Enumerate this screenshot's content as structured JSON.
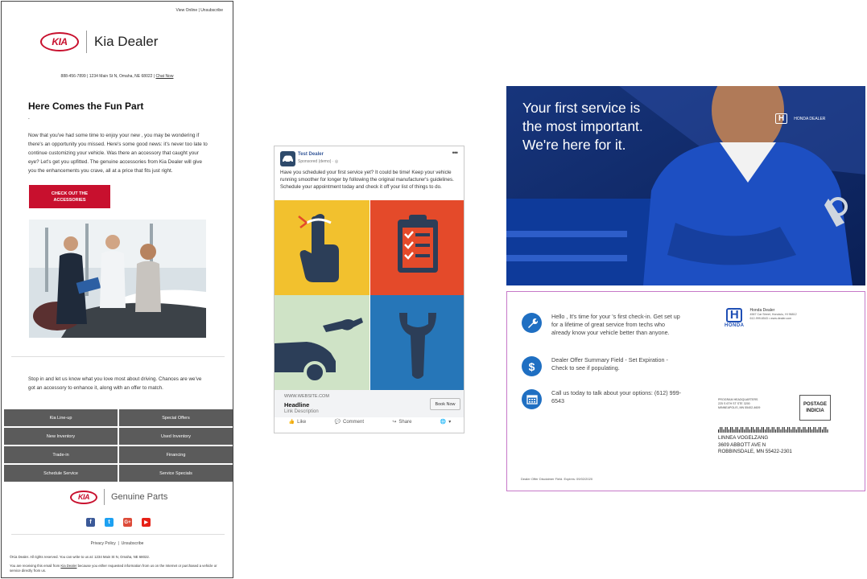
{
  "email": {
    "top_links": "View Online | Unsubscribe",
    "logo_text": "KIA",
    "dealer_name": "Kia Dealer",
    "contact_line": "888-456-7899 | 1234 Main St N, Omaha, NE 68022 | ",
    "chat_now": "Chat Now",
    "heading": "Here Comes the Fun Part",
    "dot": "-",
    "body1": "Now that you've had some time to enjoy your new , you may be wondering if there's an opportunity you missed. Here's some good news: it's never too late to continue customizing your vehicle. Was there an accessory that caught your eye? Let's get you upfitted. The genuine accessories from Kia Dealer will give you the enhancements you crave, all at a price that fits just right.",
    "cta": "CHECK OUT THE ACCESSORIES",
    "body2": "Stop in and let us know what you love most about driving. Chances are we've got an accessory to enhance it, along with an offer to match.",
    "nav": [
      "Kia Line-up",
      "Special Offers",
      "New Inventory",
      "Used Inventory",
      "Trade-in",
      "Financing",
      "Schedule Service",
      "Service Specials"
    ],
    "genuine_parts": "Genuine Parts",
    "social": [
      "f",
      "t",
      "G+",
      "▶"
    ],
    "privacy": "Privacy Policy",
    "unsubscribe": "Unsubscribe",
    "footer_copyright": "©Kia Dealer. All rights reserved. You can write to us at: 1234 Main St N, Omaha, NE 68022.",
    "footer_receiving_a": "You are receiving this email from ",
    "footer_receiving_link": "Kia Dealer",
    "footer_receiving_b": " because you either requested information from us on the Internet or purchased a vehicle or service directly from us."
  },
  "fb": {
    "page_name": "Test Dealer",
    "sponsored": "Sponsored (demo) · ",
    "post_text": "Have you scheduled your first service yet? It could be time! Keep your vehicle running smoother for longer by following the original manufacturer's guidelines. Schedule your appointment today and check it off your list of things to do.",
    "site": "WWW.WEBSITE.COM",
    "headline": "Headline",
    "link_description": "Link Description",
    "button": "Book Now",
    "like": "Like",
    "comment": "Comment",
    "share": "Share",
    "colors": {
      "yellow": "#f2c12e",
      "red": "#e44a2a",
      "green": "#cfe3c6",
      "blue": "#2676b8",
      "navy": "#2c3e58"
    }
  },
  "honda_front": {
    "headline_lines": [
      "Your first service is",
      "the most important.",
      "We're here for it."
    ],
    "logo_text": "HONDA DEALER"
  },
  "honda_back": {
    "item1": "Hello , It's time for your 's first check-in. Get set up for a lifetime of great service from techs who already know your vehicle better than anyone.",
    "item2": "Dealer Offer Summary Field - Set Expiration - Check to see if populating.",
    "item3": "Call us today to talk about your options: (612) 999-6543",
    "brand": "HONDA",
    "dealer_name": "Honda Dealer",
    "dealer_address": "4567 Car Street, Honolulu, HI 96812",
    "dealer_contact": "612-999-6543 • www.dealer.com",
    "hq_lines": [
      "PROGRAM HEADQUARTERS",
      "225 S 6TH ST STE 3200",
      "MINNEAPOLIS, MN 55402-4609"
    ],
    "postage": "POSTAGE INDICIA",
    "address_lines": [
      "LINNEA VOGELZANG",
      "3609 ABBOTT AVE N",
      "ROBBINSDALE, MN 55422-2301"
    ],
    "disclaimer": "Dealer Offer Disclaimer Field. Expires: 09/02/2020"
  }
}
